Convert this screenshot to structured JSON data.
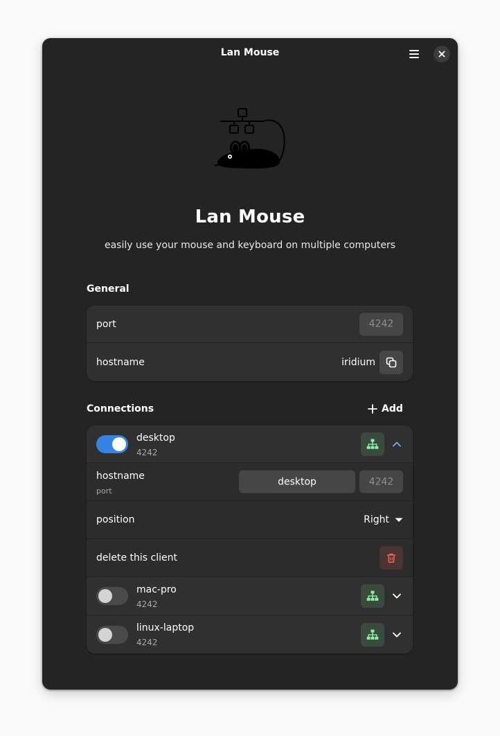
{
  "window": {
    "title": "Lan Mouse"
  },
  "hero": {
    "title": "Lan Mouse",
    "subtitle": "easily use your mouse and keyboard on multiple computers"
  },
  "general": {
    "heading": "General",
    "port_label": "port",
    "port_placeholder": "4242",
    "hostname_label": "hostname",
    "hostname_value": "iridium"
  },
  "connections": {
    "heading": "Connections",
    "add_label": "Add",
    "expanded": {
      "name": "desktop",
      "port": "4242",
      "enabled": true,
      "hostname_label": "hostname",
      "port_label": "port",
      "hostname_value": "desktop",
      "port_placeholder": "4242",
      "position_label": "position",
      "position_value": "Right",
      "delete_label": "delete this client"
    },
    "clients": [
      {
        "name": "mac-pro",
        "port": "4242",
        "enabled": false
      },
      {
        "name": "linux-laptop",
        "port": "4242",
        "enabled": false
      }
    ]
  },
  "colors": {
    "accent": "#3584e4",
    "status_green": "#8ff0a4",
    "destructive": "#f66151"
  },
  "icons": {
    "menu": "hamburger-menu-icon",
    "close": "close-icon",
    "copy": "copy-icon",
    "add": "plus-icon",
    "status": "network-icon",
    "expand": "chevron-icon",
    "delete": "trash-icon",
    "dropdown": "caret-down-icon"
  }
}
